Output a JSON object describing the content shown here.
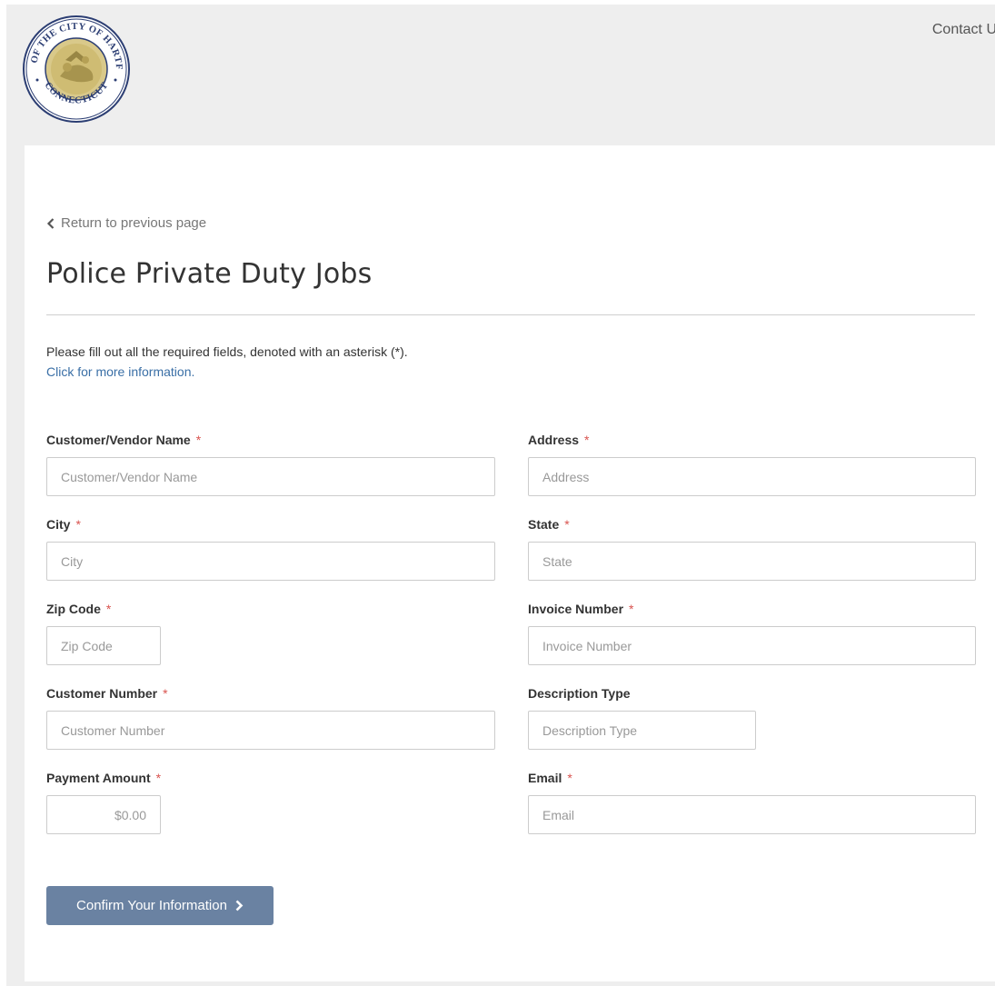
{
  "header": {
    "logo_alt": "Seal of the City of Hartford Connecticut",
    "seal_text_top": "SEAL OF THE CITY OF HARTFORD",
    "seal_text_bottom": "CONNECTICUT",
    "contact_label": "Contact Us"
  },
  "nav": {
    "back_label": "Return to previous page"
  },
  "page": {
    "title": "Police Private Duty Jobs",
    "intro": "Please fill out all the required fields, denoted with an asterisk (*).",
    "info_link": "Click for more information."
  },
  "form": {
    "required_mark": "*",
    "customer_name": {
      "label": "Customer/Vendor Name",
      "placeholder": "Customer/Vendor Name",
      "value": ""
    },
    "address": {
      "label": "Address",
      "placeholder": "Address",
      "value": ""
    },
    "city": {
      "label": "City",
      "placeholder": "City",
      "value": ""
    },
    "state": {
      "label": "State",
      "placeholder": "State",
      "value": ""
    },
    "zip": {
      "label": "Zip Code",
      "placeholder": "Zip Code",
      "value": ""
    },
    "invoice": {
      "label": "Invoice Number",
      "placeholder": "Invoice Number",
      "value": ""
    },
    "customer_number": {
      "label": "Customer Number",
      "placeholder": "Customer Number",
      "value": ""
    },
    "description_type": {
      "label": "Description Type",
      "placeholder": "Description Type",
      "value": ""
    },
    "payment_amount": {
      "label": "Payment Amount",
      "placeholder": "$0.00",
      "value": ""
    },
    "email": {
      "label": "Email",
      "placeholder": "Email",
      "value": ""
    },
    "submit_label": "Confirm Your Information"
  },
  "colors": {
    "accent": "#6a82a2",
    "link": "#3a6fa6",
    "required": "#d9534f",
    "background": "#eeeeee"
  },
  "icons": {
    "back": "chevron-left-icon",
    "submit": "chevron-right-icon"
  }
}
